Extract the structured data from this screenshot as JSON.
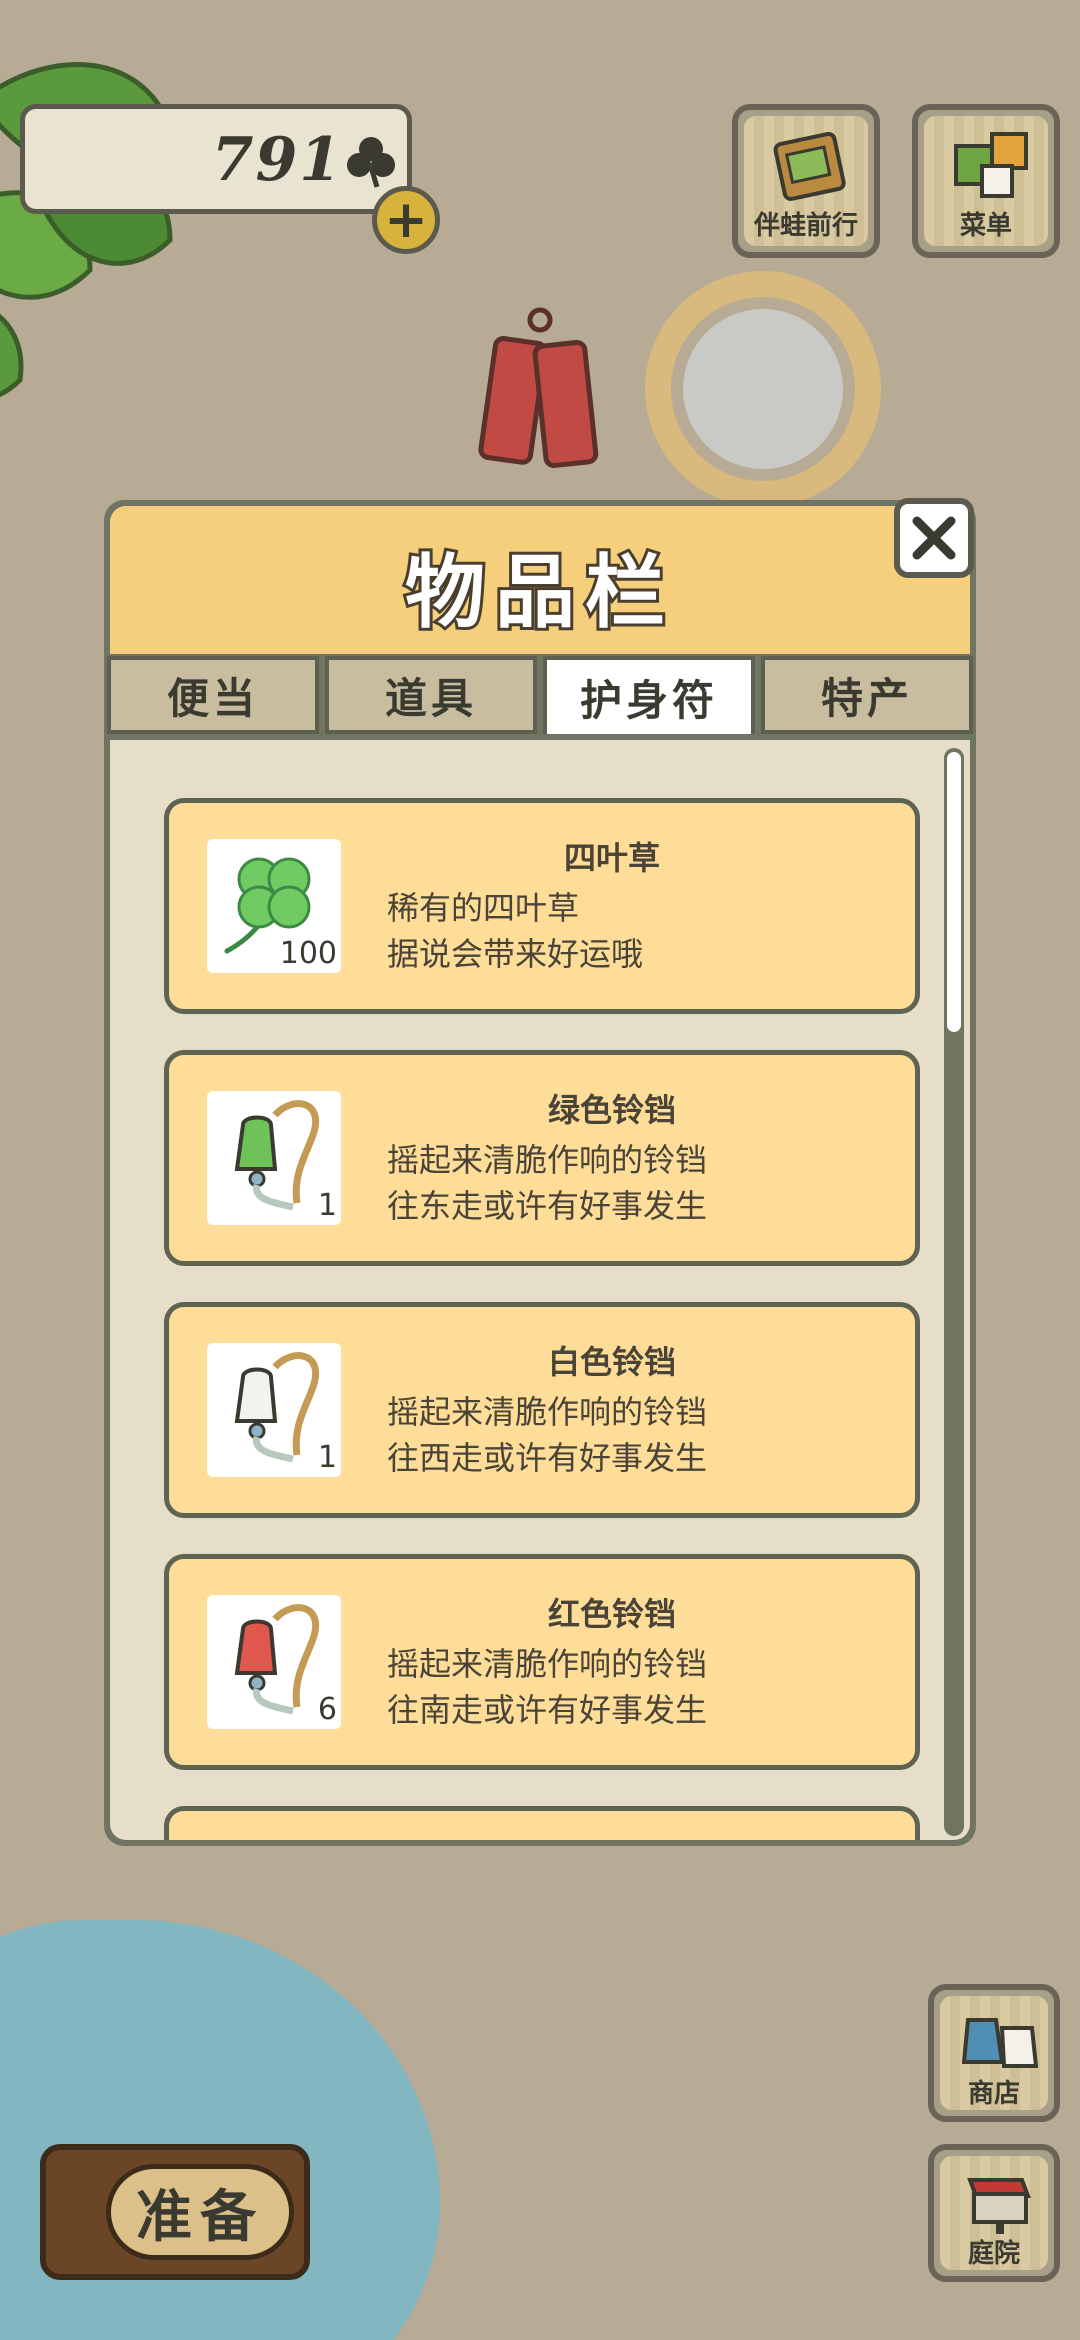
{
  "currency": {
    "amount": "791",
    "icon": "clover-icon"
  },
  "top_buttons": [
    {
      "label": "伴蛙前行",
      "icon": "journal-icon"
    },
    {
      "label": "菜单",
      "icon": "menu-icon"
    }
  ],
  "side_buttons": [
    {
      "label": "商店",
      "icon": "shop-icon"
    },
    {
      "label": "庭院",
      "icon": "mailbox-icon"
    }
  ],
  "ready_button": {
    "label": "准备"
  },
  "modal": {
    "title": "物品栏",
    "tabs": [
      {
        "label": "便当",
        "active": false
      },
      {
        "label": "道具",
        "active": false
      },
      {
        "label": "护身符",
        "active": true
      },
      {
        "label": "特产",
        "active": false
      }
    ],
    "items": [
      {
        "name": "四叶草",
        "desc1": "稀有的四叶草",
        "desc2": "据说会带来好运哦",
        "count": "100",
        "icon": "four-leaf-clover-icon"
      },
      {
        "name": "绿色铃铛",
        "desc1": "摇起来清脆作响的铃铛",
        "desc2": "往东走或许有好事发生",
        "count": "1",
        "icon": "green-bell-icon",
        "color": "#6fc25a"
      },
      {
        "name": "白色铃铛",
        "desc1": "摇起来清脆作响的铃铛",
        "desc2": "往西走或许有好事发生",
        "count": "1",
        "icon": "white-bell-icon",
        "color": "#f2f2ee"
      },
      {
        "name": "红色铃铛",
        "desc1": "摇起来清脆作响的铃铛",
        "desc2": "往南走或许有好事发生",
        "count": "6",
        "icon": "red-bell-icon",
        "color": "#e0574d"
      }
    ]
  }
}
